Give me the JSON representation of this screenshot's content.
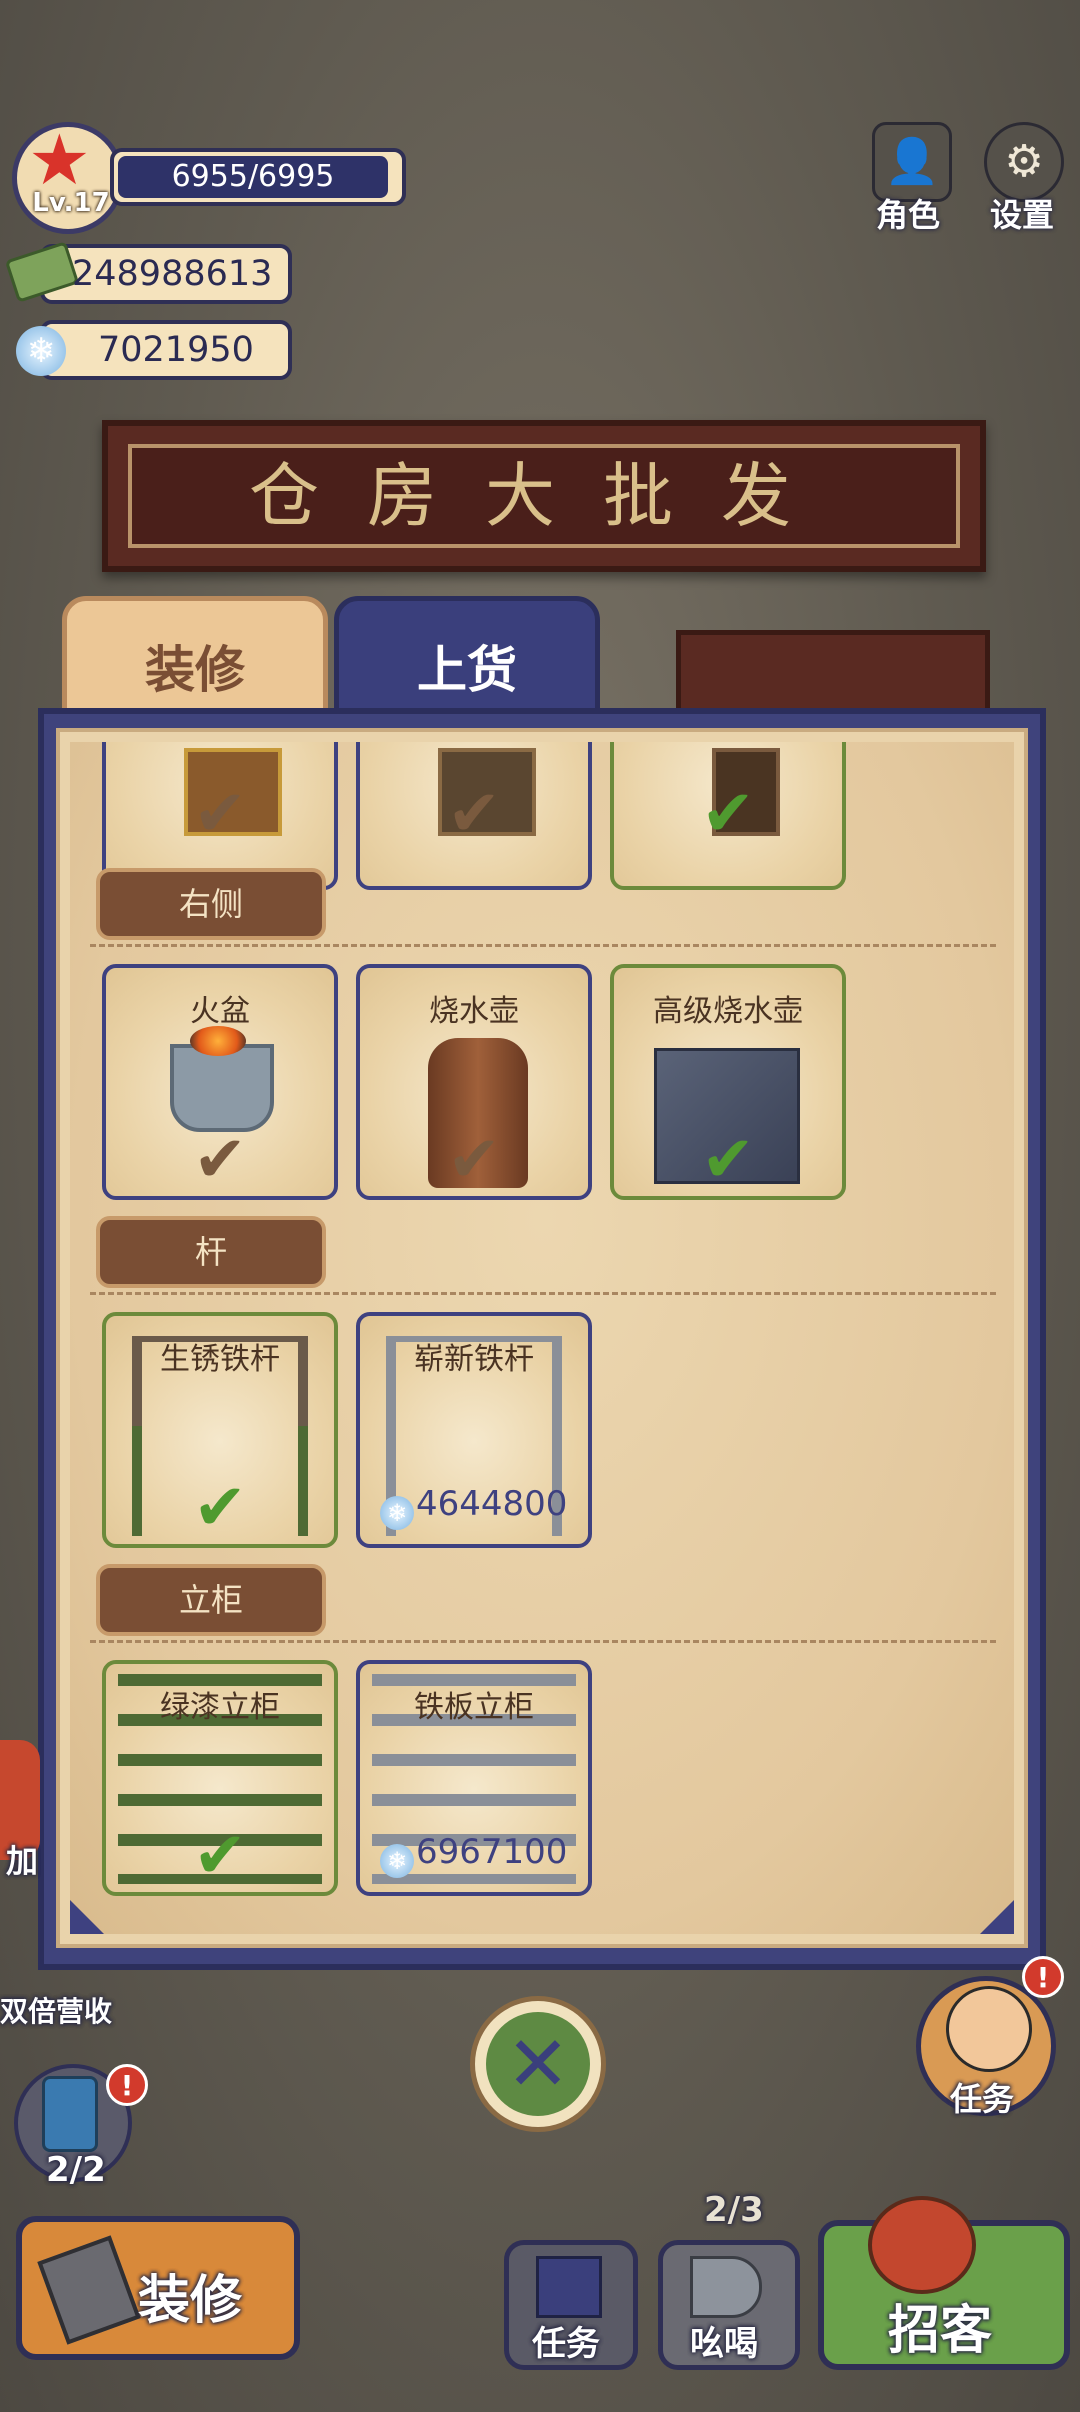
{
  "hud": {
    "level": "Lv.17",
    "energy": "6955/6995",
    "cash": "248988613",
    "gems": "7021950",
    "role_label": "角色",
    "settings_label": "设置"
  },
  "sign": {
    "title": "仓房大批发"
  },
  "tabs": {
    "deco": "装修",
    "stock": "上货"
  },
  "sections": [
    {
      "label": "右侧"
    },
    {
      "label": "杆"
    },
    {
      "label": "立柜"
    }
  ],
  "items": {
    "top": [
      {
        "owned": true,
        "selected": false
      },
      {
        "owned": true,
        "selected": false
      },
      {
        "owned": true,
        "selected": true
      }
    ],
    "right": [
      {
        "name": "火盆",
        "owned": true,
        "selected": false
      },
      {
        "name": "烧水壶",
        "owned": true,
        "selected": false
      },
      {
        "name": "高级烧水壶",
        "owned": true,
        "selected": true
      }
    ],
    "pole": [
      {
        "name": "生锈铁杆",
        "owned": true,
        "selected": true
      },
      {
        "name": "崭新铁杆",
        "owned": false,
        "price": "4644800"
      }
    ],
    "cabinet": [
      {
        "name": "绿漆立柜",
        "owned": true,
        "selected": true
      },
      {
        "name": "铁板立柜",
        "owned": false,
        "price": "6967100"
      }
    ]
  },
  "bottom": {
    "double_income": "双倍营收",
    "double_short": "加",
    "counter": "2/2",
    "deco_button": "装修",
    "task_button": "任务",
    "shout_button": "吆喝",
    "shout_count": "2/3",
    "recruit_button": "招客",
    "npc_task": "任务",
    "alert": "!"
  },
  "icons": {
    "star": "star-icon",
    "gem": "gem-icon",
    "check": "check-icon",
    "close": "close-icon"
  }
}
